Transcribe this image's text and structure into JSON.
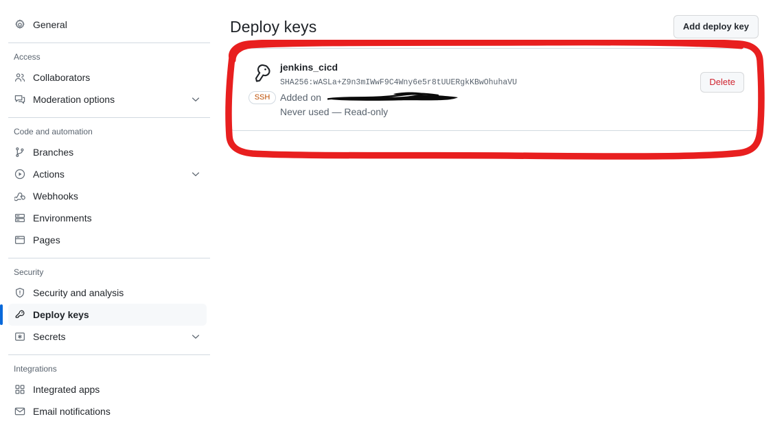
{
  "sidebar": {
    "groups": [
      {
        "title": null,
        "items": [
          {
            "label": "General",
            "icon": "gear-icon",
            "name": "general",
            "active": false,
            "chevron": false
          }
        ]
      },
      {
        "title": "Access",
        "items": [
          {
            "label": "Collaborators",
            "icon": "people-icon",
            "name": "collaborators",
            "active": false,
            "chevron": false
          },
          {
            "label": "Moderation options",
            "icon": "comment-discussion-icon",
            "name": "moderation-options",
            "active": false,
            "chevron": true
          }
        ]
      },
      {
        "title": "Code and automation",
        "items": [
          {
            "label": "Branches",
            "icon": "git-branch-icon",
            "name": "branches",
            "active": false,
            "chevron": false
          },
          {
            "label": "Actions",
            "icon": "play-icon",
            "name": "actions",
            "active": false,
            "chevron": true
          },
          {
            "label": "Webhooks",
            "icon": "webhook-icon",
            "name": "webhooks",
            "active": false,
            "chevron": false
          },
          {
            "label": "Environments",
            "icon": "server-icon",
            "name": "environments",
            "active": false,
            "chevron": false
          },
          {
            "label": "Pages",
            "icon": "browser-icon",
            "name": "pages",
            "active": false,
            "chevron": false
          }
        ]
      },
      {
        "title": "Security",
        "items": [
          {
            "label": "Security and analysis",
            "icon": "shield-icon",
            "name": "security-and-analysis",
            "active": false,
            "chevron": false
          },
          {
            "label": "Deploy keys",
            "icon": "key-icon",
            "name": "deploy-keys",
            "active": true,
            "chevron": false
          },
          {
            "label": "Secrets",
            "icon": "asterisk-key-icon",
            "name": "secrets",
            "active": false,
            "chevron": true
          }
        ]
      },
      {
        "title": "Integrations",
        "items": [
          {
            "label": "Integrated apps",
            "icon": "apps-grid-icon",
            "name": "integrated-apps",
            "active": false,
            "chevron": false
          },
          {
            "label": "Email notifications",
            "icon": "mail-icon",
            "name": "email-notifications",
            "active": false,
            "chevron": false
          }
        ]
      }
    ]
  },
  "main": {
    "title": "Deploy keys",
    "add_key_label": "Add deploy key",
    "keys": [
      {
        "name": "jenkins_cicd",
        "fingerprint": "SHA256:wASLa+Z9n3mIWwF9C4Wny6e5r8tUUERgkKBwOhuhaVU",
        "added_on_label": "Added on",
        "added_on_value": "",
        "added_on_redacted": true,
        "usage": "Never used — Read-only",
        "badge": "SSH",
        "delete_label": "Delete"
      }
    ]
  },
  "annotation": {
    "type": "hand-drawn-rectangle",
    "color": "#e81f1f"
  },
  "colors": {
    "accent": "#0969da",
    "danger": "#cf222e",
    "badge": "#bc4c00",
    "muted": "#59636e",
    "border": "#d1d9e0",
    "annotation_red": "#e81f1f"
  }
}
